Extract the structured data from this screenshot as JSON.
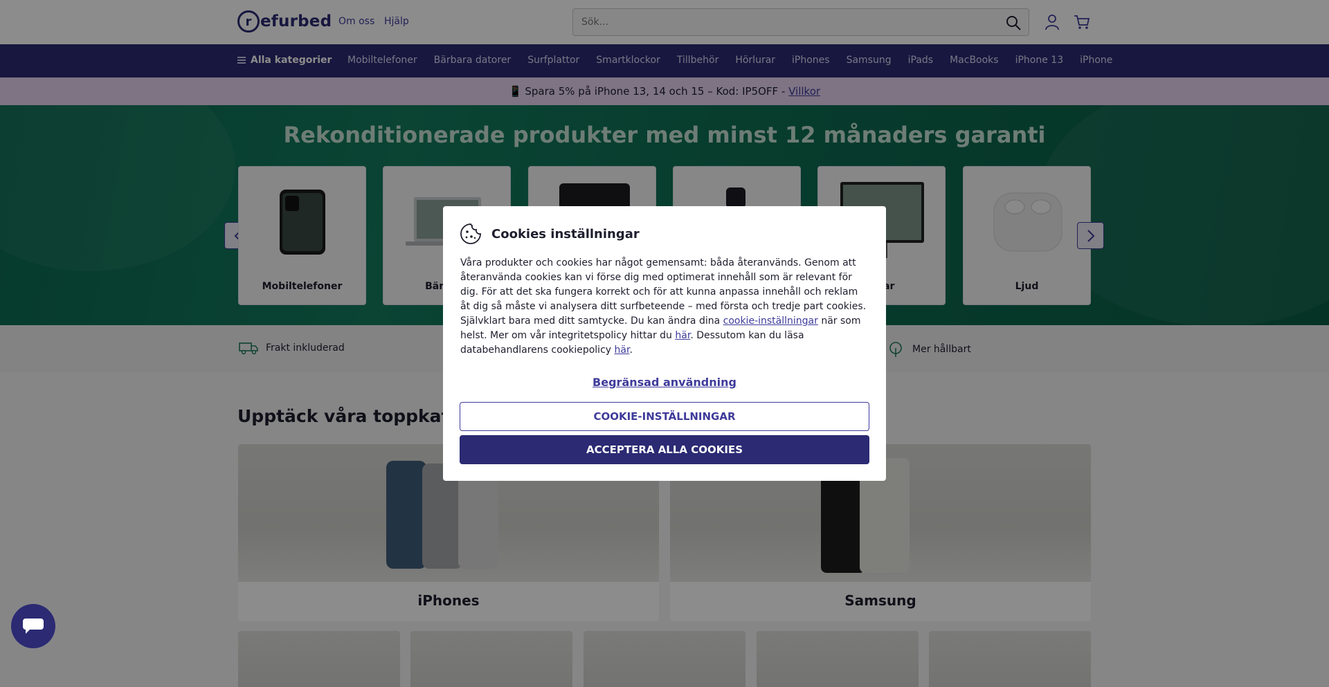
{
  "header": {
    "logo_text": "efurbed",
    "logo_letter": "r",
    "links": [
      "Om oss",
      "Hjälp"
    ],
    "search_placeholder": "Sök..."
  },
  "nav": {
    "all_categories": "Alla kategorier",
    "items": [
      "Mobiltelefoner",
      "Bärbara datorer",
      "Surfplattor",
      "Smartklockor",
      "Tillbehör",
      "Hörlurar",
      "iPhones",
      "Samsung",
      "iPads",
      "MacBooks",
      "iPhone 13",
      "iPhone"
    ]
  },
  "promo": {
    "text": "📱 Spara 5% på iPhone 13, 14 och 15 – Kod: IP5OFF - ",
    "link": "Villkor"
  },
  "hero": {
    "title": "Rekonditionerade produkter med minst 12 månaders garanti",
    "categories": [
      "Mobiltelefoner",
      "Bärbara",
      "",
      "",
      "rmar",
      "Ljud"
    ]
  },
  "usp": {
    "left": "Frakt inkluderad",
    "right": "Mer hållbart"
  },
  "section": {
    "title": "Upptäck våra toppkatego",
    "tiles": [
      "iPhones",
      "Samsung"
    ]
  },
  "cookie_modal": {
    "title": "Cookies inställningar",
    "body_1": "Våra produkter och cookies har något gemensamt: båda återanvänds. Genom att återanvända cookies kan vi förse dig med optimerat innehåll som är relevant för dig. För att det ska fungera korrekt och för att kunna anpassa innehåll och reklam åt dig så måste vi analysera ditt surfbeteende – med första och tredje part cookies. Självklart bara med ditt samtycke. Du kan ändra dina ",
    "link_settings": "cookie-inställningar",
    "body_2": " när som helst. Mer om vår integritetspolicy hittar du ",
    "link_here_1": "här",
    "body_3": ". Dessutom kan du läsa databehandlarens cookiepolicy ",
    "link_here_2": "här",
    "body_4": ".",
    "limited_use": "Begränsad användning",
    "settings_button": "COOKIE-INSTÄLLNINGAR",
    "accept_button": "ACCEPTERA ALLA COOKIES"
  },
  "colors": {
    "brand": "#2b2a73",
    "accent": "#3e3b9a",
    "hero_green": "#147c5e",
    "promo_bg": "#e6d3f1"
  }
}
